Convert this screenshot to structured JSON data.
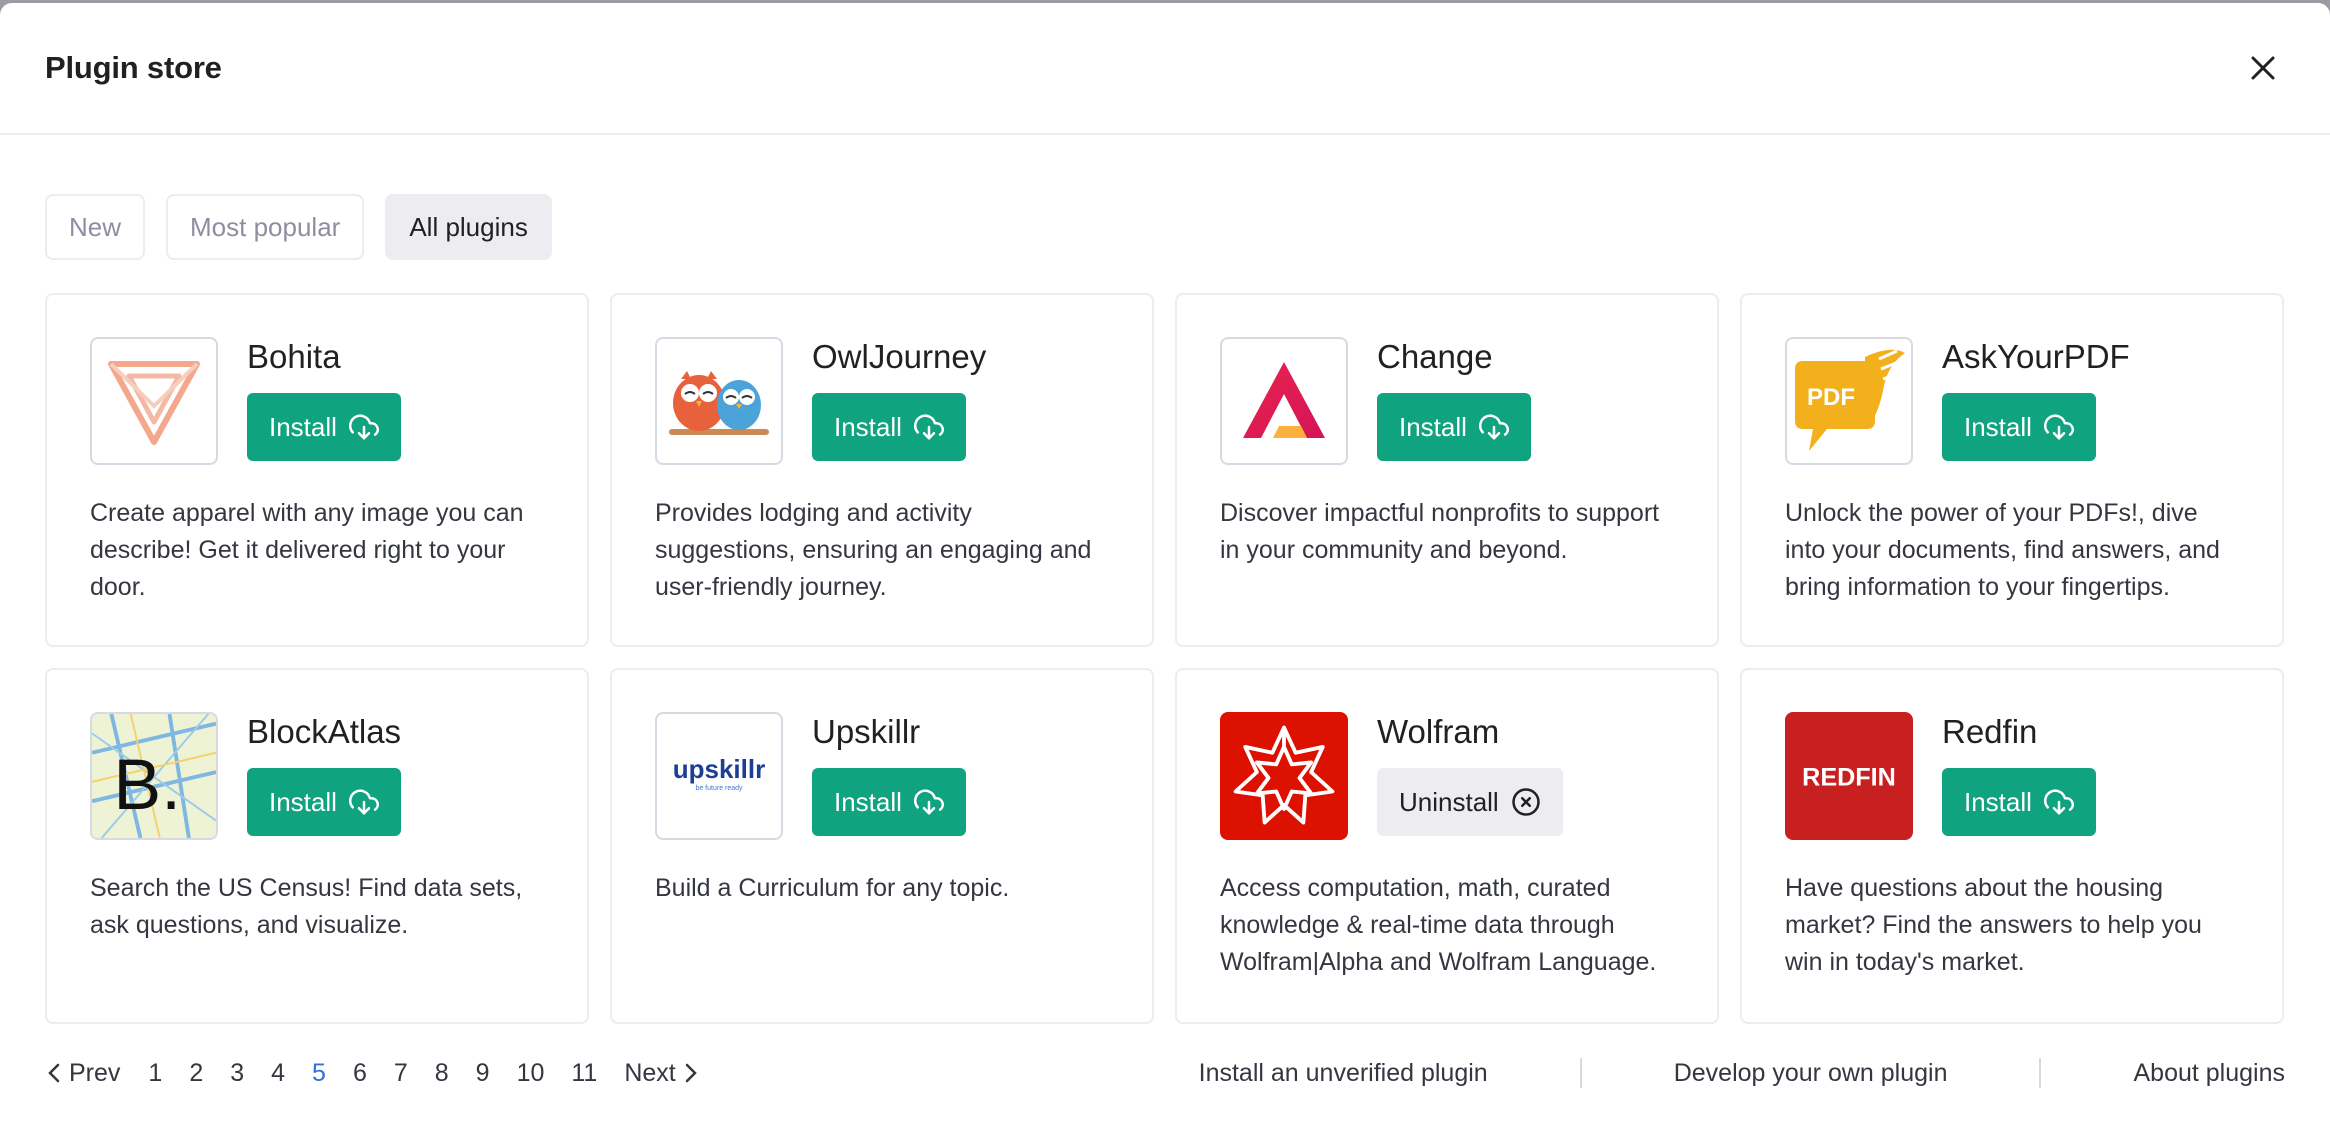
{
  "header": {
    "title": "Plugin store"
  },
  "tabs": [
    {
      "label": "New",
      "active": false
    },
    {
      "label": "Most popular",
      "active": false
    },
    {
      "label": "All plugins",
      "active": true
    }
  ],
  "plugins": [
    {
      "name": "Bohita",
      "icon": "bohita-logo",
      "button": "Install",
      "installed": false,
      "description": "Create apparel with any image you can describe! Get it delivered right to your door."
    },
    {
      "name": "OwlJourney",
      "icon": "owls-logo",
      "button": "Install",
      "installed": false,
      "description": "Provides lodging and activity suggestions, ensuring an engaging and user-friendly journey."
    },
    {
      "name": "Change",
      "icon": "change-logo",
      "button": "Install",
      "installed": false,
      "description": "Discover impactful nonprofits to support in your community and beyond."
    },
    {
      "name": "AskYourPDF",
      "icon": "pdf-logo",
      "icon_text": "PDF",
      "button": "Install",
      "installed": false,
      "description": "Unlock the power of your PDFs!, dive into your documents, find answers, and bring information to your fingertips."
    },
    {
      "name": "BlockAtlas",
      "icon": "blockatlas-logo",
      "icon_text": "B.",
      "button": "Install",
      "installed": false,
      "description": "Search the US Census! Find data sets, ask questions, and visualize."
    },
    {
      "name": "Upskillr",
      "icon": "upskillr-logo",
      "icon_text": "upskillr",
      "icon_subtext": "be future ready",
      "button": "Install",
      "installed": false,
      "description": "Build a Curriculum for any topic."
    },
    {
      "name": "Wolfram",
      "icon": "wolfram-logo",
      "button": "Uninstall",
      "installed": true,
      "description": "Access computation, math, curated knowledge & real-time data through Wolfram|Alpha and Wolfram Language."
    },
    {
      "name": "Redfin",
      "icon": "redfin-logo",
      "icon_text": "REDFIN",
      "button": "Install",
      "installed": false,
      "description": "Have questions about the housing market? Find the answers to help you win in today's market."
    }
  ],
  "pagination": {
    "prev_label": "Prev",
    "next_label": "Next",
    "pages": [
      "1",
      "2",
      "3",
      "4",
      "5",
      "6",
      "7",
      "8",
      "9",
      "10",
      "11"
    ],
    "current": "5"
  },
  "footer_links": {
    "unverified": "Install an unverified plugin",
    "develop": "Develop your own plugin",
    "about": "About plugins"
  },
  "colors": {
    "install_button": "#10a37f",
    "uninstall_button": "#ececf1",
    "current_page": "#2f6fd8"
  }
}
